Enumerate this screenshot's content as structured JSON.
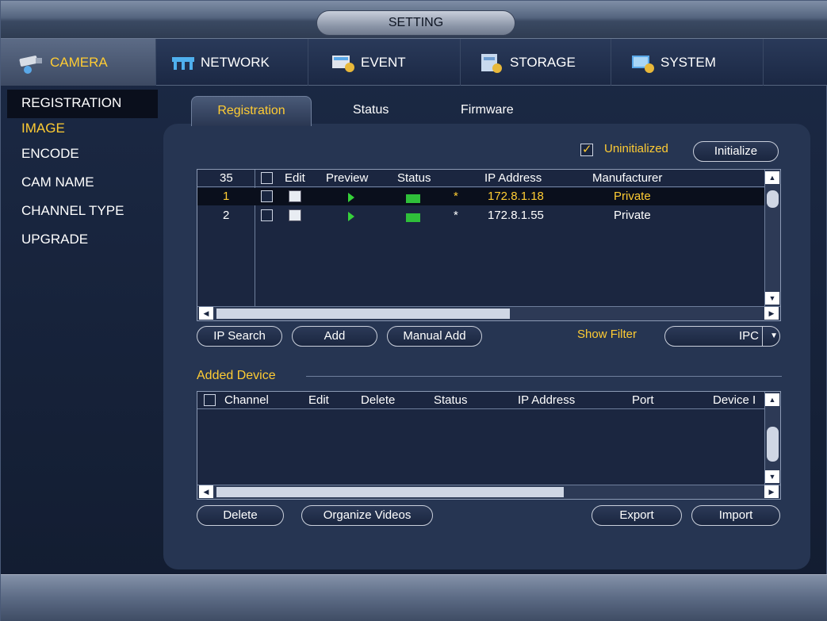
{
  "window": {
    "title": "SETTING"
  },
  "topnav": [
    {
      "label": "CAMERA",
      "icon": "camera-icon",
      "active": true
    },
    {
      "label": "NETWORK",
      "icon": "network-icon"
    },
    {
      "label": "EVENT",
      "icon": "event-icon"
    },
    {
      "label": "STORAGE",
      "icon": "storage-icon"
    },
    {
      "label": "SYSTEM",
      "icon": "system-icon"
    }
  ],
  "sidemenu": [
    {
      "label": "REGISTRATION",
      "active": true
    },
    {
      "label": "IMAGE",
      "highlight": true
    },
    {
      "label": "ENCODE"
    },
    {
      "label": "CAM NAME"
    },
    {
      "label": "CHANNEL TYPE"
    },
    {
      "label": "UPGRADE"
    }
  ],
  "tabs": {
    "registration": "Registration",
    "status": "Status",
    "firmware": "Firmware"
  },
  "uninitialized": {
    "label": "Uninitialized",
    "checked": true
  },
  "initialize_button": "Initialize",
  "search_table": {
    "count": "35",
    "headers": {
      "edit": "Edit",
      "preview": "Preview",
      "status": "Status",
      "ip": "IP Address",
      "manufacturer": "Manufacturer"
    },
    "rows": [
      {
        "no": "1",
        "flag": "*",
        "ip": "172.8.1.18",
        "manufacturer": "Private",
        "selected": true
      },
      {
        "no": "2",
        "flag": "*",
        "ip": "172.8.1.55",
        "manufacturer": "Private"
      }
    ]
  },
  "buttons": {
    "ip_search": "IP Search",
    "add": "Add",
    "manual_add": "Manual Add",
    "delete": "Delete",
    "organize": "Organize Videos",
    "export": "Export",
    "import": "Import"
  },
  "filter": {
    "label": "Show Filter",
    "value": "IPC"
  },
  "added_device": {
    "title": "Added Device",
    "headers": {
      "channel": "Channel",
      "edit": "Edit",
      "delete": "Delete",
      "status": "Status",
      "ip": "IP Address",
      "port": "Port",
      "device": "Device I"
    }
  },
  "colors": {
    "accent": "#ffcc33",
    "panel": "#263552",
    "status_green": "#2fbf3a"
  }
}
